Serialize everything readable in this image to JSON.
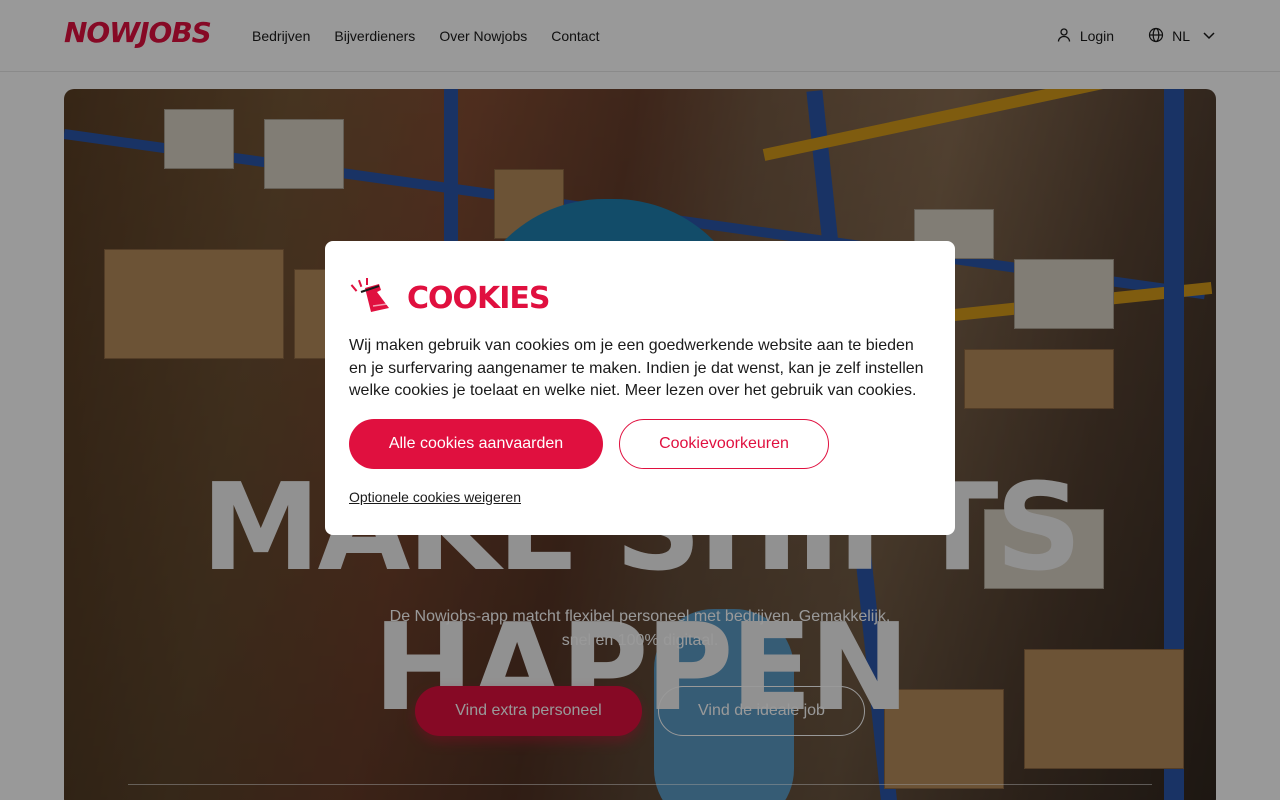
{
  "header": {
    "logo_text": "NOWJOBS",
    "nav": [
      "Bedrijven",
      "Bijverdieners",
      "Over Nowjobs",
      "Contact"
    ],
    "login_label": "Login",
    "language": "NL"
  },
  "hero": {
    "title": "MAKE SHIFTS HAPPEN",
    "subtitle": "De Nowjobs-app matcht flexibel personeel met bedrijven. Gemakkelijk, snel en 100% digitaal.",
    "primary_button": "Vind extra personeel",
    "secondary_button": "Vind de ideale job"
  },
  "cookie_modal": {
    "title": "COOKIES",
    "text": "Wij maken gebruik van cookies om je een goedwerkende website aan te bieden en je surfervaring aangenamer te maken. Indien je dat wenst, kan je zelf instellen welke cookies je toelaat en welke niet. Meer lezen over het gebruik van cookies.",
    "accept_button": "Alle cookies aanvaarden",
    "preferences_button": "Cookievoorkeuren",
    "refuse_link": "Optionele cookies weigeren"
  },
  "colors": {
    "brand": "#e0103f",
    "text": "#1a1a1a",
    "overlay": "rgba(0,0,0,0.4)"
  },
  "icons": [
    "user-icon",
    "globe-icon",
    "chevron-down-icon",
    "flask-icon"
  ]
}
